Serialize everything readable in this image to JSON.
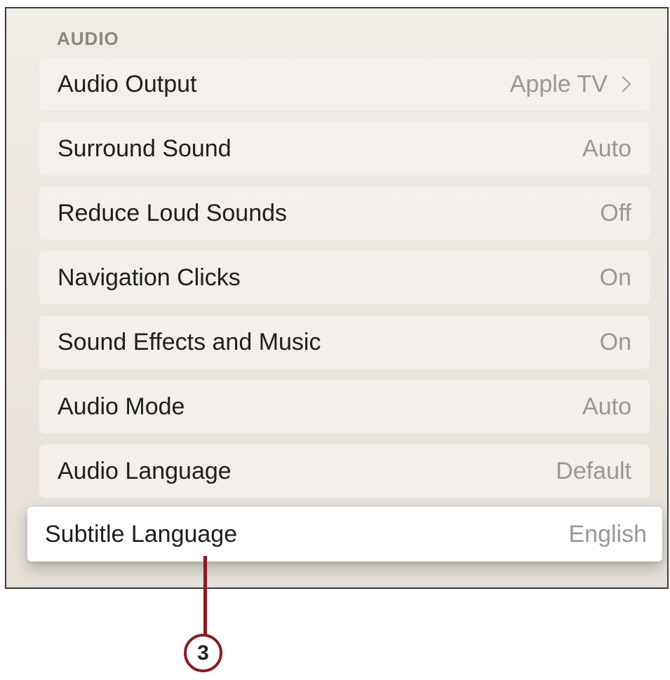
{
  "section": {
    "header": "AUDIO"
  },
  "rows": [
    {
      "label": "Audio Output",
      "value": "Apple TV",
      "chevron_icon": "chevron-right-icon"
    },
    {
      "label": "Surround Sound",
      "value": "Auto"
    },
    {
      "label": "Reduce Loud Sounds",
      "value": "Off"
    },
    {
      "label": "Navigation Clicks",
      "value": "On"
    },
    {
      "label": "Sound Effects and Music",
      "value": "On"
    },
    {
      "label": "Audio Mode",
      "value": "Auto"
    },
    {
      "label": "Audio Language",
      "value": "Default"
    },
    {
      "label": "Subtitle Language",
      "value": "English",
      "focused": true
    }
  ],
  "callout": {
    "number": "3",
    "color": "#8e1a21"
  }
}
